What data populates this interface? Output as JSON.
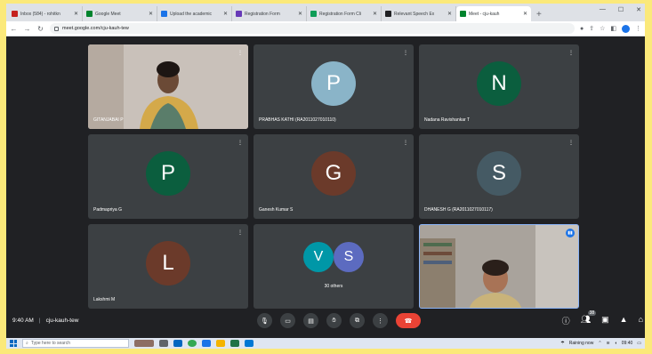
{
  "browser": {
    "tabs": [
      {
        "title": "Inbox (584) - rohitkn",
        "color": "#c5221f"
      },
      {
        "title": "Google Meet",
        "color": "#00832d"
      },
      {
        "title": "Upload the academic",
        "color": "#1a73e8"
      },
      {
        "title": "Registration Form",
        "color": "#673ab7"
      },
      {
        "title": "Registration Form Cli",
        "color": "#0f9d58"
      },
      {
        "title": "Relevant Speech Ex",
        "color": "#202124"
      },
      {
        "title": "Meet - cju-kauh",
        "color": "#00832d",
        "active": true
      }
    ],
    "url": "meet.google.com/cju-kauh-tew"
  },
  "participants": [
    {
      "name": "GITANJABAI P",
      "type": "video"
    },
    {
      "name": "PRABHAS KATHI (RA2011027010110)",
      "initial": "P",
      "color": "#8ab4c8"
    },
    {
      "name": "Nadana Ravishankar T",
      "initial": "N",
      "color": "#0b5e3e"
    },
    {
      "name": "Padmapriya G",
      "initial": "P",
      "color": "#0b5e3e"
    },
    {
      "name": "Ganesh Kumar S",
      "initial": "G",
      "color": "#6b3a2a"
    },
    {
      "name": "DHANESH G (RA2011027010117)",
      "initial": "S",
      "color": "#455a64"
    },
    {
      "name": "Lakshmi M",
      "initial": "L",
      "color": "#6b3a2a"
    },
    {
      "name": "30 others",
      "type": "others",
      "initials": [
        "V",
        "S"
      ],
      "colors": [
        "#0097a7",
        "#5c6bc0"
      ]
    },
    {
      "name": "",
      "type": "self-video"
    }
  ],
  "meeting": {
    "time": "9:40 AM",
    "code": "cju-kauh-tew",
    "people_count": "38"
  },
  "taskbar": {
    "search_placeholder": "Type here to search",
    "weather": "Raining now",
    "clock": "09:40"
  }
}
